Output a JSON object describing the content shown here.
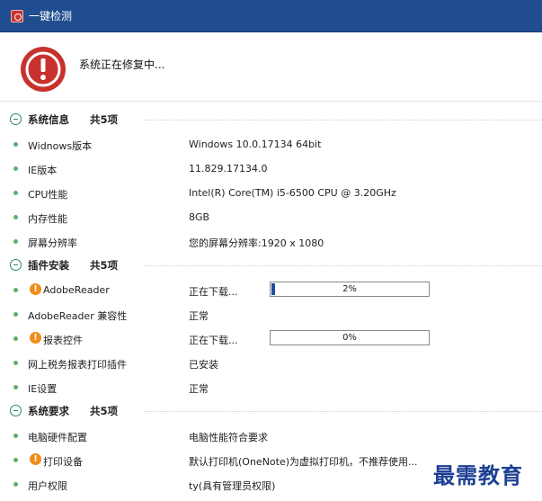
{
  "window": {
    "title": "一键检测"
  },
  "status": {
    "message": "系统正在修复中..."
  },
  "sections": [
    {
      "title": "系统信息",
      "count": "共5项",
      "rows": [
        {
          "label": "Widnows版本",
          "value": "Windows  10.0.17134  64bit"
        },
        {
          "label": "IE版本",
          "value": "11.829.17134.0"
        },
        {
          "label": "CPU性能",
          "value": "Intel(R) Core(TM) i5-6500 CPU @ 3.20GHz"
        },
        {
          "label": "内存性能",
          "value": "8GB"
        },
        {
          "label": "屏幕分辨率",
          "value": "您的屏幕分辨率:1920 x 1080"
        }
      ]
    },
    {
      "title": "插件安装",
      "count": "共5项",
      "rows": [
        {
          "label": "AdobeReader",
          "value": "正在下载...",
          "warn": true,
          "progress": 2,
          "progress_text": "2%"
        },
        {
          "label": "AdobeReader 兼容性",
          "value": "正常"
        },
        {
          "label": "报表控件",
          "value": "正在下载...",
          "warn": true,
          "progress": 0,
          "progress_text": "0%"
        },
        {
          "label": "网上税务报表打印插件",
          "value": "已安装"
        },
        {
          "label": "IE设置",
          "value": "正常"
        }
      ]
    },
    {
      "title": "系统要求",
      "count": "共5项",
      "rows": [
        {
          "label": "电脑硬件配置",
          "value": "电脑性能符合要求"
        },
        {
          "label": "打印设备",
          "value": "默认打印机(OneNote)为虚拟打印机，不推荐使用...",
          "warn": true
        },
        {
          "label": "用户权限",
          "value": "ty(具有管理员权限)"
        }
      ]
    }
  ],
  "watermark": "最需教育",
  "colors": {
    "titlebar": "#1f4d8f",
    "accent_green": "#2e8b57",
    "warning": "#f08c1a",
    "progress_fill": "#1d4f9c"
  }
}
